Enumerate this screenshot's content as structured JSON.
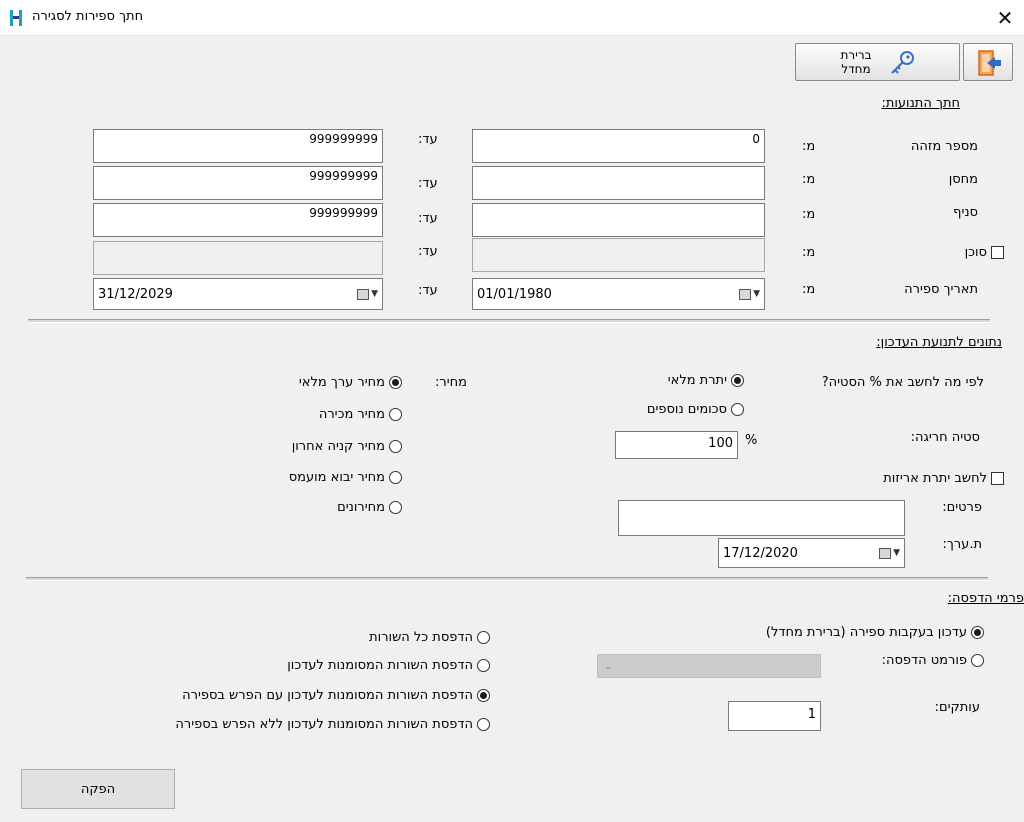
{
  "window": {
    "title": "חתך ספירות לסגירה",
    "close_glyph": "✕"
  },
  "toolbar": {
    "select_counter_label": "ברירת מחדל",
    "select_counter_icon": "key-icon",
    "exit_icon": "exit-door-icon"
  },
  "section_movement": {
    "title": "חתך התנועות:",
    "from_label": "מ:",
    "to_label": "עד:",
    "rows": [
      {
        "label": "מספר מזהה",
        "from": "0",
        "to": "999999999"
      },
      {
        "label": "מחסן",
        "from": "",
        "to": "999999999"
      },
      {
        "label": "סניף",
        "from": "",
        "to": "999999999"
      },
      {
        "label": "סוכן",
        "from": "",
        "to": ""
      }
    ],
    "count_date": {
      "label": "תאריך ספירה",
      "from": "01/01/1980",
      "to": "31/12/2029"
    }
  },
  "section_update": {
    "title": "נתונים לתנועת העדכון:",
    "deviation_question": "לפי מה לחשב את % הסטיה?",
    "option_full_balance": "יתרת מלאי",
    "option_extra_amounts": "סכומים נוספים",
    "deviation_label": "סטיה חריגה:",
    "deviation_value": "100",
    "percent_sign": "%",
    "calc_packaging_label": "לחשב יתרת אריזות",
    "details_label": "פרטים:",
    "details_value": "",
    "value_date_label": "ת.ערך:",
    "value_date": "17/12/2020",
    "price_label": "מחיר:",
    "price_options": [
      "מחיר ערך מלאי",
      "מחיר מכירה",
      "מחיר קניה אחרון",
      "מחיר יבוא מועמס",
      "מחירונים"
    ]
  },
  "section_print": {
    "title": "פרמי הדפסה:",
    "option_update_following": "עדכון בעקבות ספירה (ברירת מחדל)",
    "option_print_format": "פורמט הדפסה:",
    "copies_label": "עותקים:",
    "copies_value": "1",
    "print_options": [
      "הדפסת כל השורות",
      "הדפסת השורות המסומנות לעדכון",
      "הדפסת השורות המסומנות לעדכון עם הפרש בספירה",
      "הדפסת השורות המסומנות לעדכון ללא הפרש בספירה"
    ]
  },
  "footer": {
    "produce_button": "הפקה"
  },
  "colors": {
    "window_bg": "#f0f0f0",
    "logo_accent": "#1f9ec9",
    "exit_arrow": "#2c6cc9",
    "exit_door": "#e8731a"
  }
}
